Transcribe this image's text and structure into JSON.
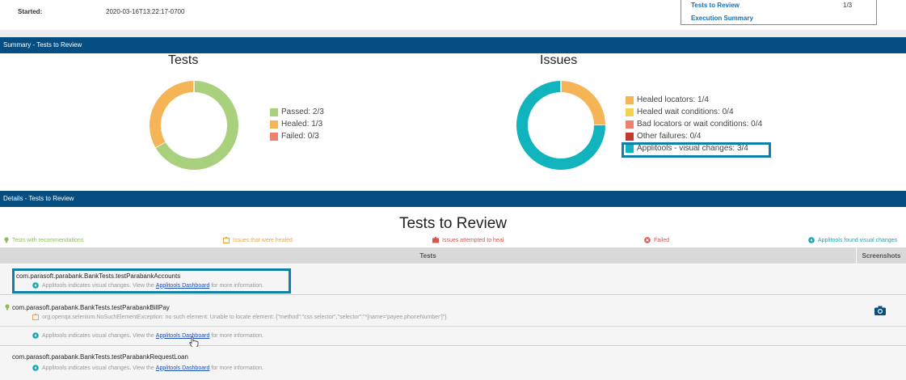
{
  "header": {
    "started_label": "Started:",
    "started_value": "2020-03-16T13:22:17-0700",
    "toc": {
      "tests_to_review": "Tests to Review",
      "tests_to_review_count": "1/3",
      "execution_summary": "Execution Summary"
    }
  },
  "summary": {
    "bar_title": "Summary - Tests to Review",
    "tests_chart": {
      "title": "Tests",
      "legend": [
        "Passed: 2/3",
        "Healed: 1/3",
        "Failed: 0/3"
      ]
    },
    "issues_chart": {
      "title": "Issues",
      "legend": [
        "Healed locators: 1/4",
        "Healed wait conditions: 0/4",
        "Bad locators or wait conditions: 0/4",
        "Other failures: 0/4",
        "Applitools - visual changes: 3/4"
      ]
    }
  },
  "chart_data": [
    {
      "type": "pie",
      "title": "Tests",
      "categories": [
        "Passed",
        "Healed",
        "Failed"
      ],
      "values": [
        2,
        1,
        0
      ],
      "total": 3,
      "colors": [
        "#a9d07c",
        "#f5b456",
        "#ef8070"
      ],
      "legend": "right"
    },
    {
      "type": "pie",
      "title": "Issues",
      "categories": [
        "Healed locators",
        "Healed wait conditions",
        "Bad locators or wait conditions",
        "Other failures",
        "Applitools - visual changes"
      ],
      "values": [
        1,
        0,
        0,
        0,
        3
      ],
      "total": 4,
      "colors": [
        "#f5b456",
        "#f3d24e",
        "#ef8070",
        "#c0392b",
        "#11b3bd"
      ],
      "legend": "right"
    }
  ],
  "details": {
    "bar_title": "Details - Tests to Review",
    "title": "Tests to Review",
    "categories": [
      {
        "label": "Tests with recommendations",
        "color": "#8fbf57"
      },
      {
        "label": "Issues that were healed",
        "color": "#f0a53c"
      },
      {
        "label": "Issues attempted to heal",
        "color": "#d9534f"
      },
      {
        "label": "Failed",
        "color": "#d9534f"
      },
      {
        "label": "Applitools found visual changes",
        "color": "#11a8b3"
      }
    ],
    "columns": {
      "tests": "Tests",
      "screenshots": "Screenshots"
    },
    "rows": [
      {
        "name": "com.parasoft.parabank.BankTests.testParabankAccounts",
        "msg_before": "Applitools indicates visual changes. View the",
        "link": "Applitools Dashboard",
        "msg_after": "for more information."
      },
      {
        "name": "com.parasoft.parabank.BankTests.testParabankBillPay",
        "error": "org.openqa.selenium.NoSuchElementException: no such element: Unable to locate element: {\"method\":\"css selector\",\"selector\":\"*[name='payee.phoneNumber']\"}",
        "msg_before": "Applitools indicates visual changes. View the",
        "link": "Applitools Dashboard",
        "msg_after": "for more information."
      },
      {
        "name": "com.parasoft.parabank.BankTests.testParabankRequestLoan",
        "msg_before": "Applitools indicates visual changes. View the",
        "link": "Applitools Dashboard",
        "msg_after": "for more information."
      }
    ]
  },
  "colors": {
    "section_bar": "#064e80",
    "highlight": "#1180a8",
    "link": "#1e4fb5"
  }
}
